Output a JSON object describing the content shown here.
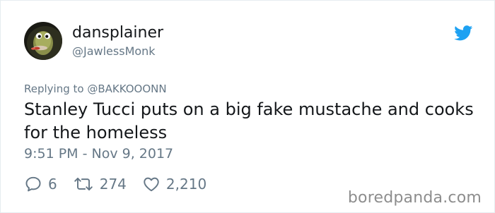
{
  "user": {
    "display_name": "dansplainer",
    "handle": "@JawlessMonk",
    "avatar_icon": "turtle-avatar-icon"
  },
  "platform_icon": "twitter-bird-icon",
  "brand_color": "#1da1f2",
  "reply": {
    "label": "Replying to @BAKKOOONN"
  },
  "tweet": {
    "text": "Stanley Tucci puts on a big fake mustache and cooks for the homeless",
    "timestamp": "9:51 PM - Nov 9, 2017"
  },
  "actions": {
    "replies": {
      "icon": "reply-icon",
      "count": "6"
    },
    "retweets": {
      "icon": "retweet-icon",
      "count": "274"
    },
    "likes": {
      "icon": "heart-icon",
      "count": "2,210"
    }
  },
  "watermark": "boredpanda.com"
}
